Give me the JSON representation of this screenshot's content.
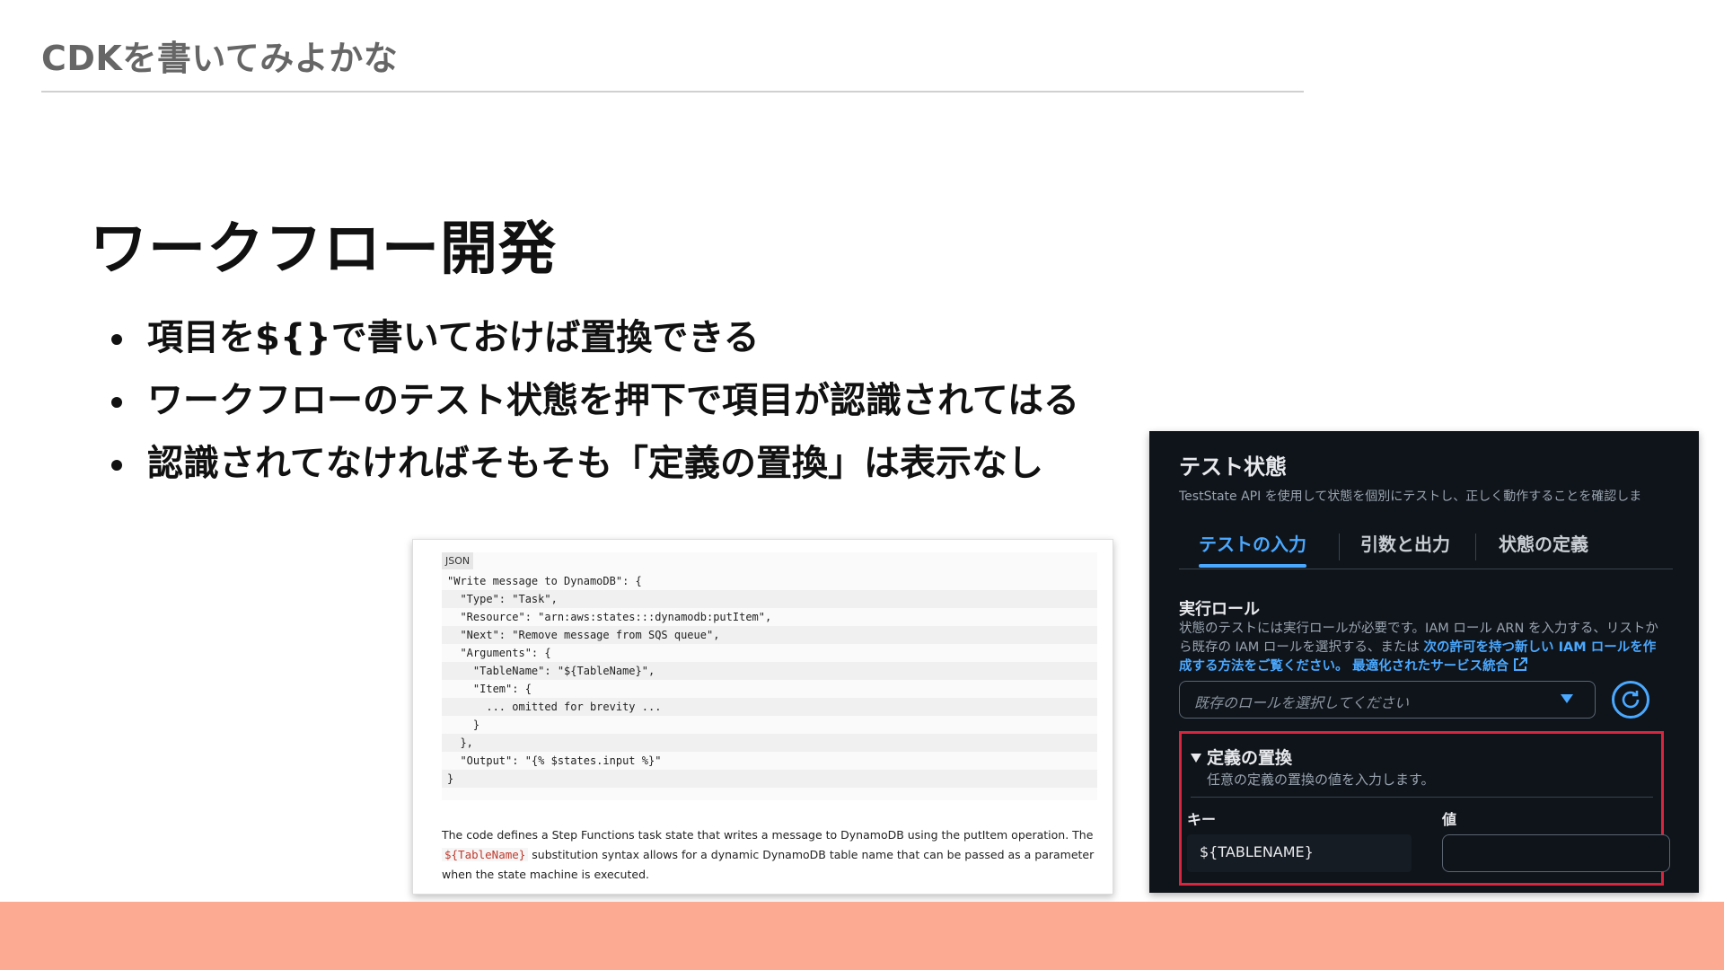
{
  "header": {
    "title": "CDKを書いてみよかな"
  },
  "slide": {
    "title": "ワークフロー開発",
    "bullets": [
      "項目を${}で書いておけば置換できる",
      "ワークフローのテスト状態を押下で項目が認識されてはる",
      "認識されてなければそもそも「定義の置換」は表示なし"
    ]
  },
  "doc_screenshot": {
    "code_tag": "JSON",
    "code_lines": [
      "\"Write message to DynamoDB\": {",
      "  \"Type\": \"Task\",",
      "  \"Resource\": \"arn:aws:states:::dynamodb:putItem\",",
      "  \"Next\": \"Remove message from SQS queue\",",
      "  \"Arguments\": {",
      "    \"TableName\": \"${TableName}\",",
      "    \"Item\": {",
      "      ... omitted for brevity ...",
      "    }",
      "  },",
      "  \"Output\": \"{% $states.input %}\"",
      "}"
    ],
    "text_before": "The code defines a Step Functions task state that writes a message to DynamoDB using the putItem operation. The ",
    "inline_code": "${TableName}",
    "text_after": " substitution syntax allows for a dynamic DynamoDB table name that can be passed as a parameter when the state machine is executed."
  },
  "console_screenshot": {
    "title": "テスト状態",
    "description": "TestState API を使用して状態を個別にテストし、正しく動作することを確認しま",
    "tabs": [
      "テストの入力",
      "引数と出力",
      "状態の定義"
    ],
    "active_tab": 0,
    "role_label": "実行ロール",
    "role_help_text": "状態のテストには実行ロールが必要です。IAM ロール ARN を入力する、リストから既存の IAM ロールを選択する、または ",
    "role_help_link1": "次の許可を持つ新しい IAM ロールを作成する方法をご覧ください。",
    "role_help_link2": "最適化されたサービス統合",
    "role_placeholder": "既存のロールを選択してください",
    "override_title": "定義の置換",
    "override_desc": "任意の定義の置換の値を入力します。",
    "key_header": "キー",
    "value_header": "値",
    "key_value": "${TABLENAME}",
    "value_value": "",
    "colors": {
      "accent": "#4aa8ff",
      "highlight_border": "#d7263d",
      "background": "#0f141a"
    }
  },
  "colors": {
    "bottom_band": "#fcab92",
    "header_text": "#666666"
  }
}
